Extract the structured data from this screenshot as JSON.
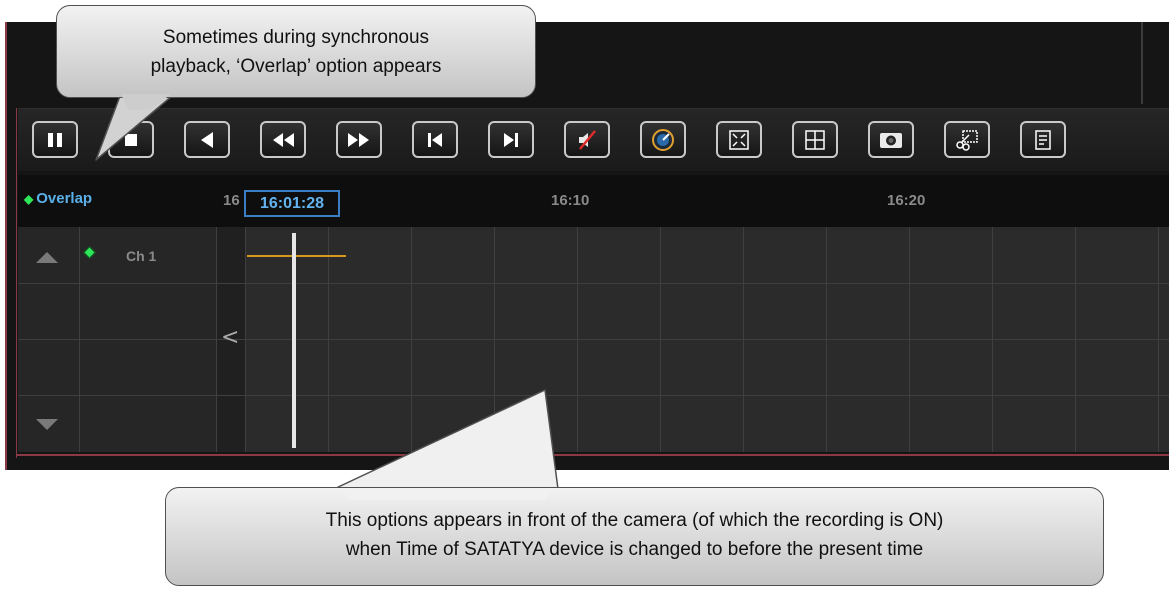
{
  "callouts": {
    "top": {
      "line1": "Sometimes during synchronous",
      "line2": "playback, ‘Overlap’ option appears"
    },
    "bottom": {
      "line1": "This options appears in front of the camera (of which the recording is ON)",
      "line2": "when Time of SATATYA device is changed to before the present time"
    }
  },
  "toolbar": {
    "buttons": [
      {
        "name": "pause-icon"
      },
      {
        "name": "stop-icon"
      },
      {
        "name": "reverse-play-icon"
      },
      {
        "name": "rewind-icon"
      },
      {
        "name": "fast-forward-icon"
      },
      {
        "name": "skip-previous-icon"
      },
      {
        "name": "skip-next-icon"
      },
      {
        "name": "mute-icon"
      },
      {
        "name": "speed-gauge-icon"
      },
      {
        "name": "fullscreen-icon"
      },
      {
        "name": "layout-grid-icon"
      },
      {
        "name": "snapshot-camera-icon"
      },
      {
        "name": "clip-cut-icon"
      },
      {
        "name": "notes-icon"
      }
    ]
  },
  "timeline": {
    "overlap_label": "Overlap",
    "overlap_dot": "◆",
    "ticks": [
      "16",
      "16:10",
      "16:20"
    ],
    "current_time": "16:01:28",
    "collapse_arrow": "<"
  },
  "channels": [
    {
      "label": "Ch 1"
    }
  ],
  "colors": {
    "accent_blue": "#5ab0e8",
    "overlap_green": "#2ee65a",
    "recording_bar": "#d49a1e",
    "panel_dark": "#151515"
  }
}
